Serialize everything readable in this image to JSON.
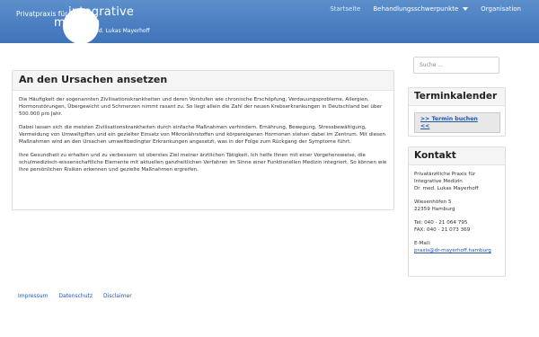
{
  "header": {
    "logo": {
      "line1": "Privatpraxis für",
      "word1": "integrative",
      "word2": "medizin",
      "line3": "Dr. med. Lukas Mayerhoff"
    },
    "nav": [
      {
        "label": "Startseite"
      },
      {
        "label": "Behandlungsschwerpunkte"
      },
      {
        "label": "Organisation"
      }
    ]
  },
  "main": {
    "title": "An den Ursachen ansetzen",
    "paragraphs": [
      "Die Häufigkeit der sogenannten Zivilisationskrankheiten und deren Vorstufen wie chronische Erschöpfung, Verdauungsprobleme, Allergien, Hormonstörungen, Übergewicht und Schmerzen nimmt rasant zu. So liegt allein die Zahl der neuen Krebserkrankungen in Deutschland bei über 500.000 pro Jahr.",
      "Dabei lassen sich die meisten Zivilisationskrankheiten durch einfache Maßnahmen verhindern. Ernährung, Bewegung, Stressbewältigung, Vermeidung von Umweltgiften und ein gezielter Einsatz von Mikronährstoffen und körpereigenen Hormonen stehen dabei im Zentrum. Mit diesen Maßnahmen wird an den Ursachen umweltbedingter Erkrankungen angesetzt, was in der Folge zum Rückgang der Symptome führt.",
      "Ihre Gesundheit zu erhalten und zu verbessern ist oberstes Ziel meiner ärztlichen Tätigkeit. Ich helfe Ihnen mit einer Vorgehensweise, die schulmedizisch-wissenschaftliche Elemente mit aktuellen ganzheitlichen Verfahren im Sinne einer Funktionellen Medizin integriert. So können wie Ihre persönlichen Risiken erkennen und gezielte Maßnahmen ergreifen."
    ]
  },
  "sidebar": {
    "search_placeholder": "Suche ...",
    "termin": {
      "title": "Terminkalender",
      "button_line1": ">> Termin buchen",
      "button_line2": "<<"
    },
    "kontakt": {
      "title": "Kontakt",
      "name_lines": [
        "Privatärztliche Praxis für",
        "Integrative Medizin",
        "Dr. med. Lukas Mayerhoff"
      ],
      "address_lines": [
        "Wiesenhöfen 5",
        "22359 Hamburg"
      ],
      "phone": "Tel: 040 - 21 064 795",
      "fax": "FAX: 040 - 21 073 369",
      "email_label": "E-Mail:",
      "email": "praxis@dr-mayerhoff.hamburg"
    }
  },
  "footer": {
    "links": [
      {
        "label": "Impressum"
      },
      {
        "label": "Datenschutz"
      },
      {
        "label": "Disclaimer"
      }
    ]
  }
}
